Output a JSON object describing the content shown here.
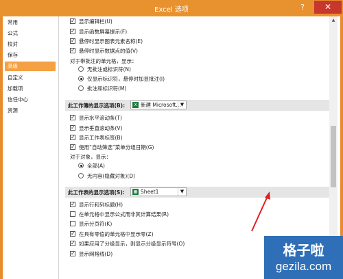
{
  "window": {
    "title": "Excel 选项",
    "help_glyph": "?",
    "close_glyph": "✕"
  },
  "sidebar": {
    "items": [
      {
        "label": "常用"
      },
      {
        "label": "公式"
      },
      {
        "label": "校对"
      },
      {
        "label": "保存"
      },
      {
        "label": "高级",
        "active": true
      },
      {
        "label": "自定义"
      },
      {
        "label": "加载项"
      },
      {
        "label": "信任中心"
      },
      {
        "label": "资源"
      }
    ]
  },
  "display": {
    "items": [
      {
        "label": "显示编辑栏(U)",
        "checked": true
      },
      {
        "label": "显示函数屏幕提示(F)",
        "checked": true
      },
      {
        "label": "悬停时显示图表元素名称(E)",
        "checked": true
      },
      {
        "label": "悬停时显示数据点的值(V)",
        "checked": true
      }
    ],
    "comment_label": "对于带批注的单元格，显示：",
    "comment_options": [
      {
        "label": "无批注或标识符(N)",
        "selected": false
      },
      {
        "label": "仅显示标识符，悬停时加显批注(I)",
        "selected": true
      },
      {
        "label": "批注和标识符(M)",
        "selected": false
      }
    ]
  },
  "workbook_section": {
    "label": "此工作簿的显示选项(B):",
    "select_value": "新建 Microsoft...",
    "select_icon": "excel-file-icon",
    "items": [
      {
        "label": "显示水平滚动条(T)",
        "checked": true
      },
      {
        "label": "显示垂直滚动条(V)",
        "checked": true
      },
      {
        "label": "显示工作表标签(B)",
        "checked": true
      },
      {
        "label": "使用“自动筛选”菜单分组日期(G)",
        "checked": true
      }
    ],
    "objects_label": "对于对象，显示：",
    "objects_options": [
      {
        "label": "全部(A)",
        "selected": true
      },
      {
        "label": "无内容(隐藏对象)(D)",
        "selected": false
      }
    ]
  },
  "worksheet_section": {
    "label": "此工作表的显示选项(S):",
    "select_value": "Sheet1",
    "select_icon": "sheet-icon",
    "items": [
      {
        "label": "显示行和列标题(H)",
        "checked": true
      },
      {
        "label": "在单元格中显示公式而非其计算结果(R)",
        "checked": false
      },
      {
        "label": "显示分页符(K)",
        "checked": false
      },
      {
        "label": "在具有零值的单元格中显示零(Z)",
        "checked": true
      },
      {
        "label": "如果应用了分级显示，则显示分级显示符号(O)",
        "checked": true
      },
      {
        "label": "显示网格线(D)",
        "checked": true
      }
    ]
  },
  "watermark": {
    "chinese": "格子啦",
    "domain": "gezila.com"
  },
  "colors": {
    "titlebar": "#e8912f",
    "active_nav": "#f5a043",
    "close_button": "#c7372c",
    "annotation_arrow": "#e02020",
    "watermark_bg": "#2f6fb7"
  }
}
